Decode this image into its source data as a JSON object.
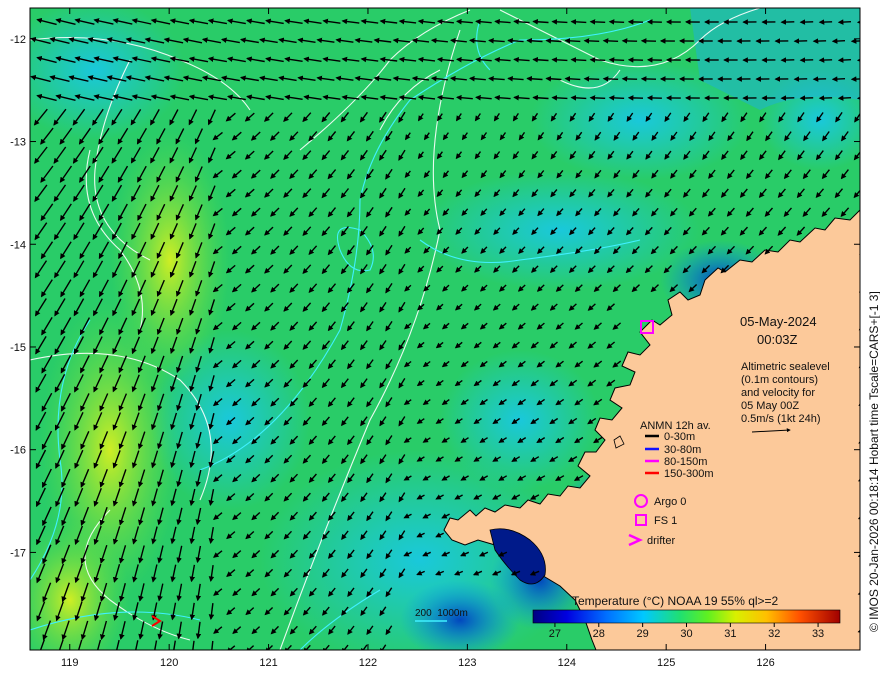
{
  "map": {
    "lon_ticks": [
      "119",
      "120",
      "121",
      "122",
      "123",
      "124",
      "125",
      "126"
    ],
    "lat_ticks": [
      "-12",
      "-13",
      "-14",
      "-15",
      "-16",
      "-17"
    ],
    "lon_range": [
      118.6,
      126.95
    ],
    "lat_range": [
      -17.95,
      -11.7
    ]
  },
  "annotation": {
    "date": "05-May-2024",
    "time": "00:03Z",
    "description_lines": [
      "Altimetric sealevel",
      "(0.1m contours)",
      "and velocity for",
      "05 May 00Z",
      "0.5m/s (1kt 24h)"
    ]
  },
  "legend": {
    "title": "ANMN 12h av.",
    "depths": [
      {
        "label": "0-30m",
        "color": "#000000"
      },
      {
        "label": "30-80m",
        "color": "#1010ff"
      },
      {
        "label": "80-150m",
        "color": "#ff00ff"
      },
      {
        "label": "150-300m",
        "color": "#ff0000"
      }
    ],
    "symbols": [
      {
        "label": "Argo 0",
        "icon": "circle",
        "color": "#ff00ff"
      },
      {
        "label": "FS 1",
        "icon": "square",
        "color": "#ff00ff"
      },
      {
        "label": "drifter",
        "icon": "chevron",
        "color": "#ff00ff"
      }
    ]
  },
  "bathy_legend": {
    "label": "200  1000m"
  },
  "colorbar": {
    "title": "Temperature (°C) NOAA 19 55% ql>=2",
    "ticks": [
      "27",
      "28",
      "29",
      "30",
      "31",
      "32",
      "33"
    ],
    "range": [
      26.5,
      33.5
    ]
  },
  "side_caption": "© IMOS 20-Jan-2026 00:18:14 Hobart time Tscale=CARS+[-1 3]",
  "colors": {
    "land": "#fcc99a",
    "coast": "#000000",
    "contour": "#ffffff",
    "isobath": "#00ffff",
    "marker": "#ff00ff"
  }
}
